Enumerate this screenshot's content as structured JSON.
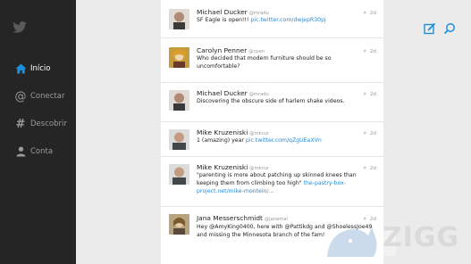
{
  "sidebar": {
    "items": [
      {
        "label": "Início",
        "icon": "home-icon",
        "active": true
      },
      {
        "label": "Conectar",
        "icon": "at-icon",
        "active": false
      },
      {
        "label": "Descobrir",
        "icon": "hashtag-icon",
        "active": false
      },
      {
        "label": "Conta",
        "icon": "user-icon",
        "active": false
      }
    ]
  },
  "colors": {
    "sidebar_bg": "#252525",
    "accent": "#1e8ed8",
    "link": "#2a8ad4",
    "background": "#ebebeb"
  },
  "actions": {
    "compose_icon": "compose-icon",
    "search_icon": "search-icon"
  },
  "tweets": [
    {
      "name": "Michael Ducker",
      "handle": "@mradu",
      "time": "2d",
      "pre": "SF Eagle is open!!! ",
      "link": "pic.twitter.com/dwjepR30pj",
      "post": ""
    },
    {
      "name": "Carolyn Penner",
      "handle": "@cpen",
      "time": "2d",
      "pre": "Who decided that modern furniture should be so uncomfortable?",
      "link": "",
      "post": ""
    },
    {
      "name": "Michael Ducker",
      "handle": "@mradu",
      "time": "2d",
      "pre": "Discovering the obscure side of harlem shake videos.",
      "link": "",
      "post": ""
    },
    {
      "name": "Mike Kruzeniski",
      "handle": "@mkruz",
      "time": "2d",
      "pre": "1 (amazing) year ",
      "link": "pic.twitter.com/qZgUEaXVn",
      "post": ""
    },
    {
      "name": "Mike Kruzeniski",
      "handle": "@mkruz",
      "time": "2d",
      "pre": "\"parenting is more about patching up skinned knees than keeping them from climbing too high\" ",
      "link": "the-pastry-box-project.net/mike-montein/...",
      "post": ""
    },
    {
      "name": "Jana Messerschmidt",
      "handle": "@janamal",
      "time": "2d",
      "pre": "Hey @AmyKing0400, here with @Pattikdg and @ShoelessJoe49 and missing the Minnesota branch of the fam!",
      "link": "",
      "post": ""
    }
  ],
  "watermark": {
    "text": "ZIGG"
  }
}
